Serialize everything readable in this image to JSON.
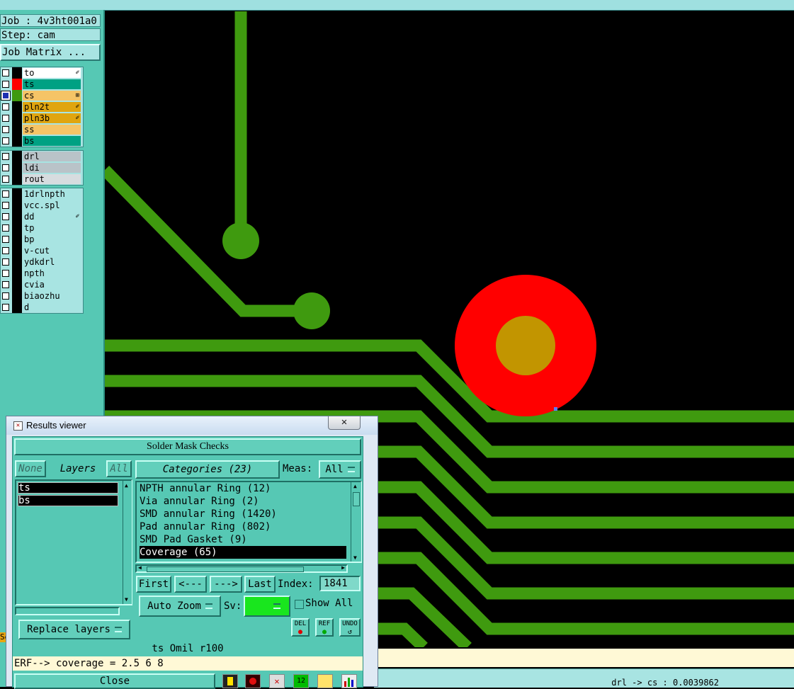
{
  "job": {
    "label": "Job : 4v3ht001a0",
    "step": "Step: cam",
    "matrix_button": "Job Matrix ..."
  },
  "layers": {
    "board": [
      {
        "name": "to",
        "color": "#000000",
        "bg": "#ffffff",
        "mark": "✐"
      },
      {
        "name": "ts",
        "color": "#ff0000",
        "bg": "#00a183",
        "mark": ""
      },
      {
        "name": "cs",
        "color": "#3f9a0f",
        "bg": "#f5c466",
        "mark": "⊞",
        "active": true
      },
      {
        "name": "pln2t",
        "color": "#000000",
        "bg": "#e0a510",
        "mark": "✐"
      },
      {
        "name": "pln3b",
        "color": "#000000",
        "bg": "#e0a510",
        "mark": "✐"
      },
      {
        "name": "ss",
        "color": "#000000",
        "bg": "#f5c466",
        "mark": ""
      },
      {
        "name": "bs",
        "color": "#000000",
        "bg": "#00a183",
        "mark": ""
      }
    ],
    "drill": [
      {
        "name": "drl",
        "color": "#000000",
        "bg": "#b9c3c8"
      },
      {
        "name": "ldi",
        "color": "#000000",
        "bg": "#b9c3c8"
      },
      {
        "name": "rout",
        "color": "#000000",
        "bg": "#d7dcdf"
      }
    ],
    "misc": [
      {
        "name": "1drlnpth",
        "color": "#000000",
        "bg": "#a8e4e2",
        "mark": ""
      },
      {
        "name": "vcc.spl",
        "color": "#000000",
        "bg": "#a8e4e2",
        "mark": ""
      },
      {
        "name": "dd",
        "color": "#000000",
        "bg": "#a8e4e2",
        "mark": "✐"
      },
      {
        "name": "tp",
        "color": "#000000",
        "bg": "#a8e4e2",
        "mark": ""
      },
      {
        "name": "bp",
        "color": "#000000",
        "bg": "#a8e4e2",
        "mark": ""
      },
      {
        "name": "v-cut",
        "color": "#000000",
        "bg": "#a8e4e2",
        "mark": ""
      },
      {
        "name": "ydkdrl",
        "color": "#000000",
        "bg": "#a8e4e2",
        "mark": ""
      },
      {
        "name": "npth",
        "color": "#000000",
        "bg": "#a8e4e2",
        "mark": ""
      },
      {
        "name": "cvia",
        "color": "#000000",
        "bg": "#a8e4e2",
        "mark": ""
      },
      {
        "name": "biaozhu",
        "color": "#000000",
        "bg": "#a8e4e2",
        "mark": ""
      },
      {
        "name": "d",
        "color": "#000000",
        "bg": "#a8e4e2",
        "mark": ""
      }
    ]
  },
  "results_viewer": {
    "title": "Results viewer",
    "close_glyph": "✕",
    "header": "Solder Mask Checks",
    "none_button": "None",
    "layers_label": "Layers",
    "all_button": "All",
    "layer_list": [
      "ts",
      "bs"
    ],
    "categories_label": "Categories (23)",
    "meas_label": "Meas:",
    "meas_value": "All",
    "categories": [
      "NPTH annular Ring (12)",
      "Via annular Ring (2)",
      "SMD annular Ring (1420)",
      "Pad annular Ring (802)",
      "SMD Pad Gasket (9)",
      "Coverage (65)"
    ],
    "selected_category_index": 5,
    "nav": {
      "first": "First",
      "prev": "<---",
      "next": "--->",
      "last": "Last",
      "index_label": "Index:",
      "index_value": "1841"
    },
    "auto_zoom": "Auto Zoom",
    "sv_label": "Sv:",
    "sv_color": "#19e61e",
    "show_all": "Show All",
    "replace_layers": "Replace layers",
    "del_label": "DEL",
    "ref_label": "REF",
    "undo_label": "UNDO",
    "status_line": "ts   Omil   r100",
    "erf_line": "ERF--> coverage = 2.5 6 8",
    "close_button": "Close"
  },
  "status": {
    "coords": "drl -> cs : 0.0039862",
    "left_cut": "Se"
  },
  "colors": {
    "copper": "#3f9a0f",
    "mask_open": "#ff0000",
    "pad_overlap": "#c29500",
    "panel": "#56c8b4"
  }
}
